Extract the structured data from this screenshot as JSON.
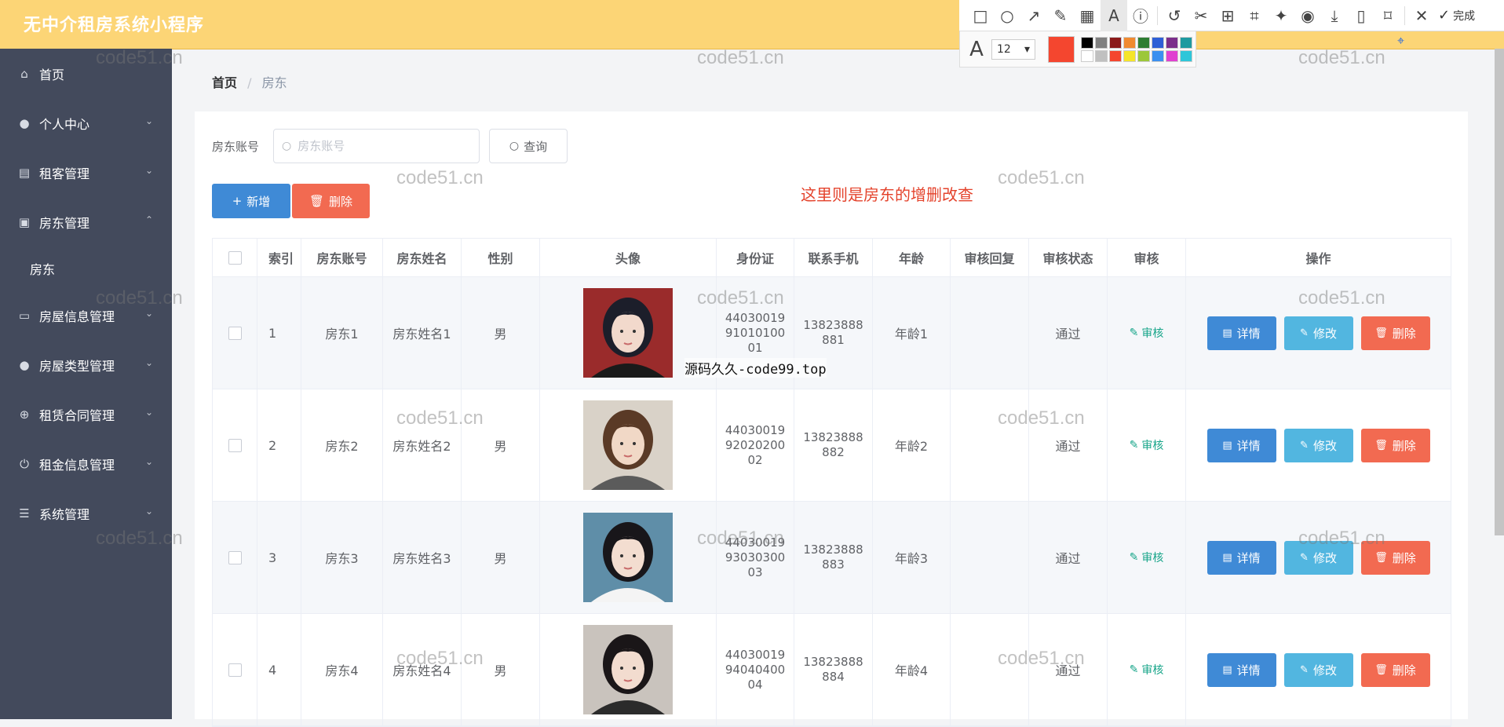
{
  "app": {
    "title": "无中介租房系统小程序"
  },
  "shot_tool": {
    "tools": [
      "rect-icon",
      "ellipse-icon",
      "arrow-icon",
      "pen-icon",
      "mosaic-icon",
      "text-icon",
      "number-icon",
      "undo-icon",
      "cut-icon",
      "translate-icon",
      "ocr-icon",
      "pin-icon",
      "record-icon",
      "download-icon",
      "phone-icon",
      "bookmark-icon",
      "close-icon"
    ],
    "done_label": "完成",
    "font_size": "12",
    "current_color": "#f4462f",
    "palette": [
      "#000000",
      "#808080",
      "#8b1a1a",
      "#f08a30",
      "#2e7d32",
      "#2e5fd6",
      "#7b2e8a",
      "#1e9aa0",
      "#ffffff",
      "#c0c0c0",
      "#f4462f",
      "#f5e52a",
      "#9cc73a",
      "#3b90f0",
      "#e040d0",
      "#2ec6d9"
    ]
  },
  "sidebar": {
    "items": [
      {
        "label": "首页",
        "icon": "home-icon",
        "expandable": false
      },
      {
        "label": "个人中心",
        "icon": "user-icon",
        "expandable": true
      },
      {
        "label": "租客管理",
        "icon": "book-icon",
        "expandable": true
      },
      {
        "label": "房东管理",
        "icon": "clipboard-icon",
        "expandable": true,
        "expanded": true
      },
      {
        "label": "房屋信息管理",
        "icon": "monitor-icon",
        "expandable": true
      },
      {
        "label": "房屋类型管理",
        "icon": "user-icon",
        "expandable": true
      },
      {
        "label": "租赁合同管理",
        "icon": "compass-icon",
        "expandable": true
      },
      {
        "label": "租金信息管理",
        "icon": "power-icon",
        "expandable": true
      },
      {
        "label": "系统管理",
        "icon": "menu-icon",
        "expandable": true
      }
    ],
    "sub_item": "房东"
  },
  "breadcrumb": {
    "home": "首页",
    "sep": "/",
    "current": "房东"
  },
  "filter": {
    "label": "房东账号",
    "placeholder": "房东账号",
    "query_label": "查询"
  },
  "actions": {
    "add_label": "新增",
    "delete_label": "删除"
  },
  "annotation": "这里则是房东的增删改查",
  "table": {
    "headers": [
      "索引",
      "房东账号",
      "房东姓名",
      "性别",
      "头像",
      "身份证",
      "联系手机",
      "年龄",
      "审核回复",
      "审核状态",
      "审核",
      "操作"
    ],
    "audit_label": "审核",
    "op_labels": {
      "detail": "详情",
      "edit": "修改",
      "delete": "删除"
    },
    "rows": [
      {
        "index": "1",
        "account": "房东1",
        "name": "房东姓名1",
        "gender": "男",
        "id_card": [
          "44030019",
          "91010100",
          "01"
        ],
        "phone": [
          "13823888",
          "881"
        ],
        "age": "年龄1",
        "reply": "",
        "status": "通过"
      },
      {
        "index": "2",
        "account": "房东2",
        "name": "房东姓名2",
        "gender": "男",
        "id_card": [
          "44030019",
          "92020200",
          "02"
        ],
        "phone": [
          "13823888",
          "882"
        ],
        "age": "年龄2",
        "reply": "",
        "status": "通过"
      },
      {
        "index": "3",
        "account": "房东3",
        "name": "房东姓名3",
        "gender": "男",
        "id_card": [
          "44030019",
          "93030300",
          "03"
        ],
        "phone": [
          "13823888",
          "883"
        ],
        "age": "年龄3",
        "reply": "",
        "status": "通过"
      },
      {
        "index": "4",
        "account": "房东4",
        "name": "房东姓名4",
        "gender": "男",
        "id_card": [
          "44030019",
          "94040400",
          "04"
        ],
        "phone": [
          "13823888",
          "884"
        ],
        "age": "年龄4",
        "reply": "",
        "status": "通过"
      }
    ]
  },
  "overlay_text": "源码久久-code99.top",
  "watermark": "code51.cn"
}
